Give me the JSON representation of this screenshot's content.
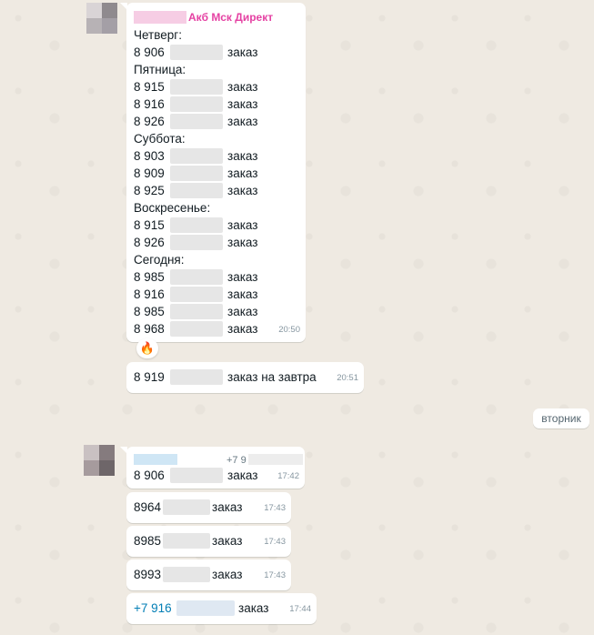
{
  "colors": {
    "wallpaper": "#efeae2",
    "bubble": "#ffffff",
    "sender_name": "#e542a3",
    "timestamp": "#8696a0",
    "link": "#027eb5"
  },
  "messages": [
    {
      "sender": "Акб Мск Директ",
      "time": "20:50",
      "lines": [
        "Четверг:",
        "8 906",
        "заказ",
        "Пятница:",
        "8 915",
        "заказ",
        "8 916",
        "заказ",
        "8 926",
        "заказ",
        "Суббота:",
        "8 903",
        "заказ",
        "8 909",
        "заказ",
        "8 925",
        "заказ",
        "Воскресенье:",
        "8 915",
        "заказ",
        "8 926",
        "заказ",
        "Сегодня:",
        "8 985",
        "заказ",
        "8 916",
        "заказ",
        "8 985",
        "заказ",
        "8 968",
        "заказ"
      ],
      "reaction": "fire-icon",
      "reaction_glyph": "🔥"
    },
    {
      "number": "8 919",
      "text": "заказ на завтра",
      "time": "20:51"
    }
  ],
  "date_chip": "вторник",
  "group2": {
    "phone_prefix": "+7 9",
    "first": {
      "number": "8 906",
      "text": "заказ",
      "time": "17:42"
    },
    "items": [
      {
        "number": "8964",
        "text": "заказ",
        "time": "17:43"
      },
      {
        "number": "8985",
        "text": "заказ",
        "time": "17:43"
      },
      {
        "number": "8993",
        "text": "заказ",
        "time": "17:43"
      },
      {
        "number": "+7 916",
        "text": "заказ",
        "time": "17:44"
      }
    ]
  }
}
